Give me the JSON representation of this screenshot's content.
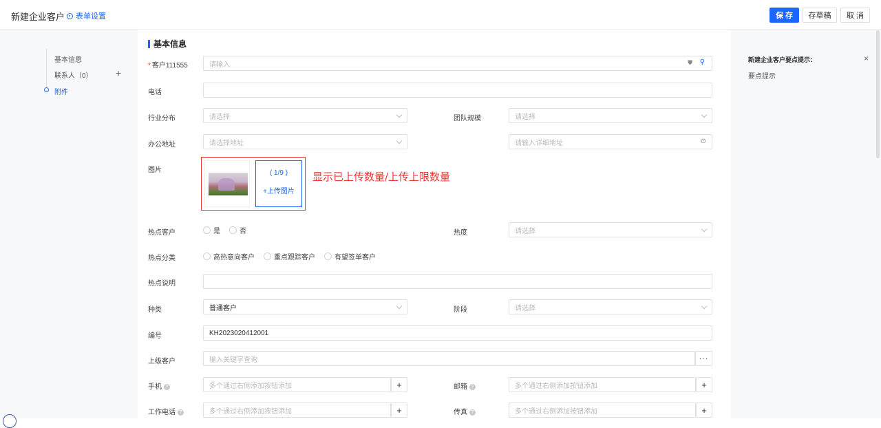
{
  "header": {
    "title": "新建企业客户",
    "form_settings": "表单设置",
    "save": "保 存",
    "draft": "存草稿",
    "cancel": "取 消"
  },
  "nav": {
    "items": [
      {
        "label": "基本信息"
      },
      {
        "label": "联系人（0）"
      },
      {
        "label": "附件"
      }
    ],
    "add": "+"
  },
  "section": {
    "title": "基本信息"
  },
  "fields": {
    "customer": {
      "label": "客户111555",
      "required": "*",
      "placeholder": "请输入"
    },
    "phone": {
      "label": "电话"
    },
    "industry": {
      "label": "行业分布",
      "placeholder": "请选择"
    },
    "team_size": {
      "label": "团队规模",
      "placeholder": "请选择"
    },
    "office": {
      "label": "办公地址",
      "placeholder": "请选择地址",
      "detail_placeholder": "请输入详细地址"
    },
    "image": {
      "label": "图片",
      "count": "( 1/9 )",
      "upload": "+上传图片",
      "annotation": "显示已上传数量/上传上限数量"
    },
    "hot_customer": {
      "label": "热点客户",
      "options": [
        "是",
        "否"
      ]
    },
    "heat": {
      "label": "热度",
      "placeholder": "请选择"
    },
    "hot_category": {
      "label": "热点分类",
      "options": [
        "高热意向客户",
        "重点跟踪客户",
        "有望签单客户"
      ]
    },
    "hot_desc": {
      "label": "热点说明"
    },
    "kind": {
      "label": "种类",
      "value": "普通客户"
    },
    "stage": {
      "label": "阶段",
      "placeholder": "请选择"
    },
    "number": {
      "label": "编号",
      "value": "KH2023020412001"
    },
    "parent": {
      "label": "上级客户",
      "placeholder": "输入关键字查询",
      "more": "···"
    },
    "mobile": {
      "label": "手机",
      "placeholder": "多个通过右侧添加按钮添加"
    },
    "email": {
      "label": "邮箱",
      "placeholder": "多个通过右侧添加按钮添加"
    },
    "work_phone": {
      "label": "工作电话",
      "placeholder": "多个通过右侧添加按钮添加"
    },
    "fax": {
      "label": "传真",
      "placeholder": "多个通过右侧添加按钮添加"
    }
  },
  "tips": {
    "title": "新建企业客户要点提示：",
    "body": "要点提示",
    "close": "×"
  },
  "colors": {
    "accent": "#1a66ff",
    "annotation": "#e33333"
  }
}
